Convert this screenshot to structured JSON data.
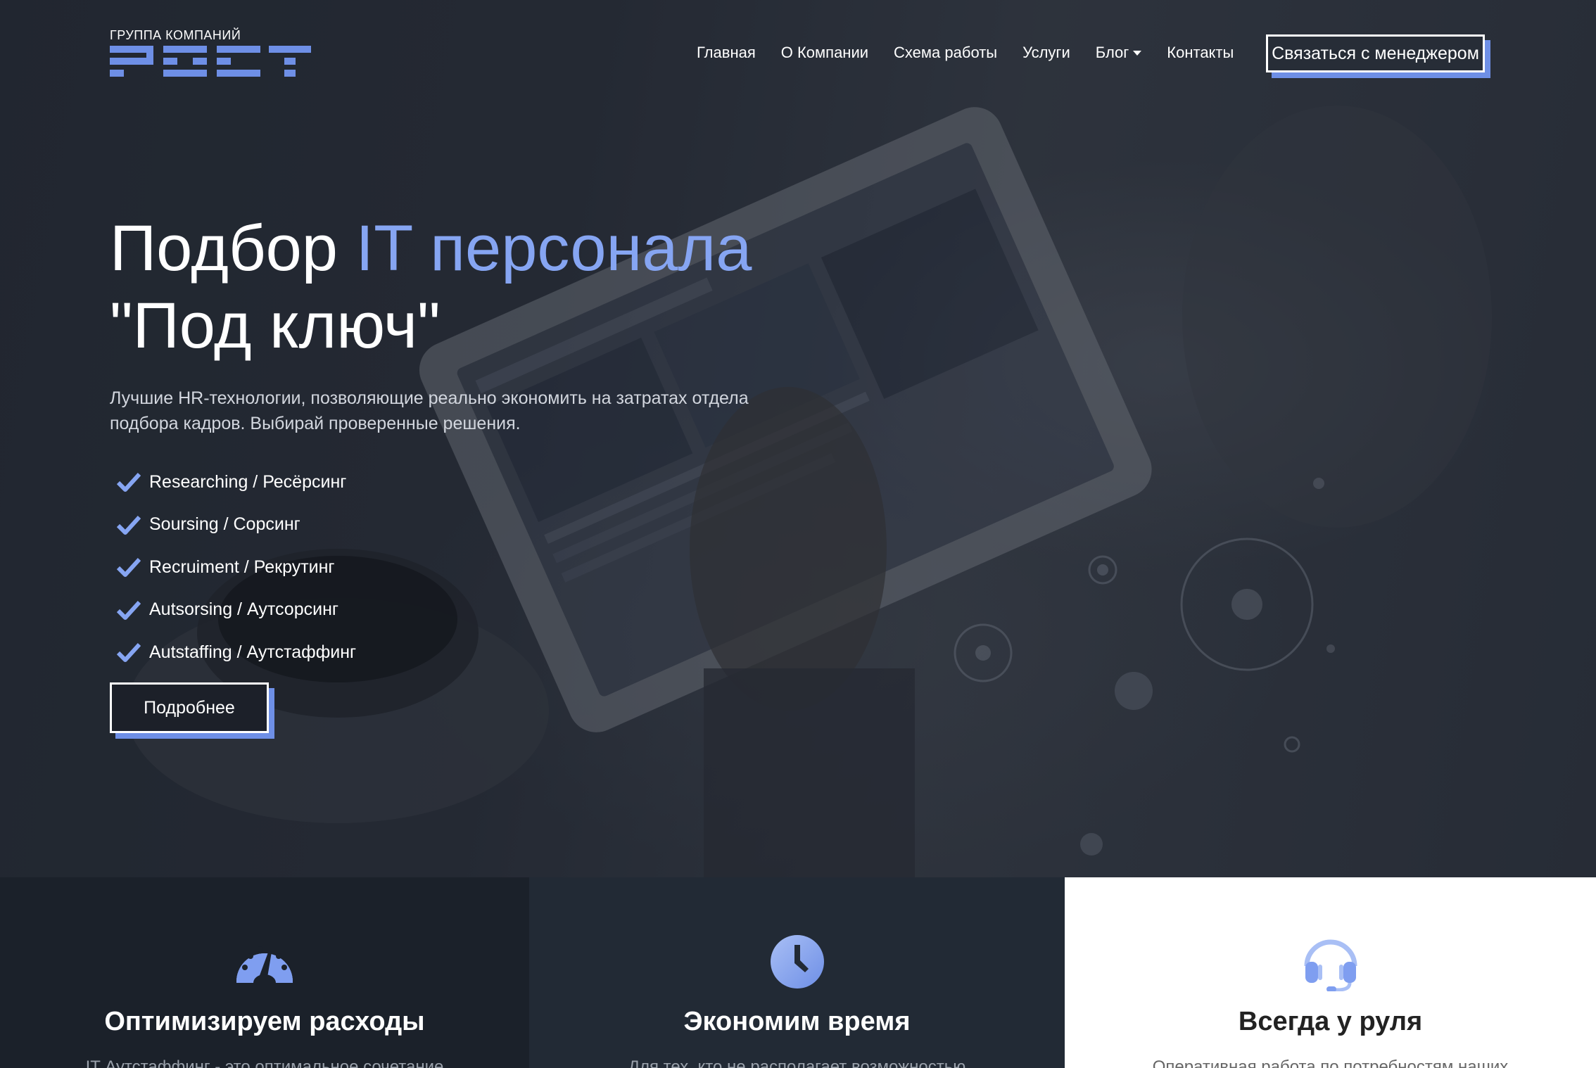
{
  "brand": {
    "caption": "ГРУППА КОМПАНИЙ",
    "name": "РОСТ"
  },
  "nav": {
    "items": [
      {
        "label": "Главная"
      },
      {
        "label": "О Компании"
      },
      {
        "label": "Схема работы"
      },
      {
        "label": "Услуги"
      },
      {
        "label": "Блог",
        "has_dropdown": true
      },
      {
        "label": "Контакты"
      }
    ],
    "cta_label": "Связаться с менеджером"
  },
  "hero": {
    "title_part1": "Подбор ",
    "title_accent": "IT персонала",
    "title_line2": "\"Под ключ\"",
    "subtitle": "Лучшие HR-технологии, позволяющие реально экономить на затратах отдела подбора кадров. Выбирай проверенные решения.",
    "features": [
      "Researching / Ресёрсинг",
      "Soursing / Сорсинг",
      "Recruiment / Рекрутинг",
      "Autsorsing / Аутсорсинг",
      "Autstaffing / Аутстаффинг"
    ],
    "more_label": "Подробнее"
  },
  "cards": [
    {
      "icon": "speedometer-icon",
      "title": "Оптимизируем расходы",
      "text": "IT Аутстаффинг - это оптимальное сочетание"
    },
    {
      "icon": "clock-icon",
      "title": "Экономим время",
      "text": "Для тех, кто не располагает возможностью"
    },
    {
      "icon": "headset-icon",
      "title": "Всегда у руля",
      "text": "Оперативная работа по потребностям наших"
    }
  ],
  "colors": {
    "accent": "#86a5f2",
    "button_shadow": "#6e8fe6",
    "dark": "#1b212a"
  }
}
